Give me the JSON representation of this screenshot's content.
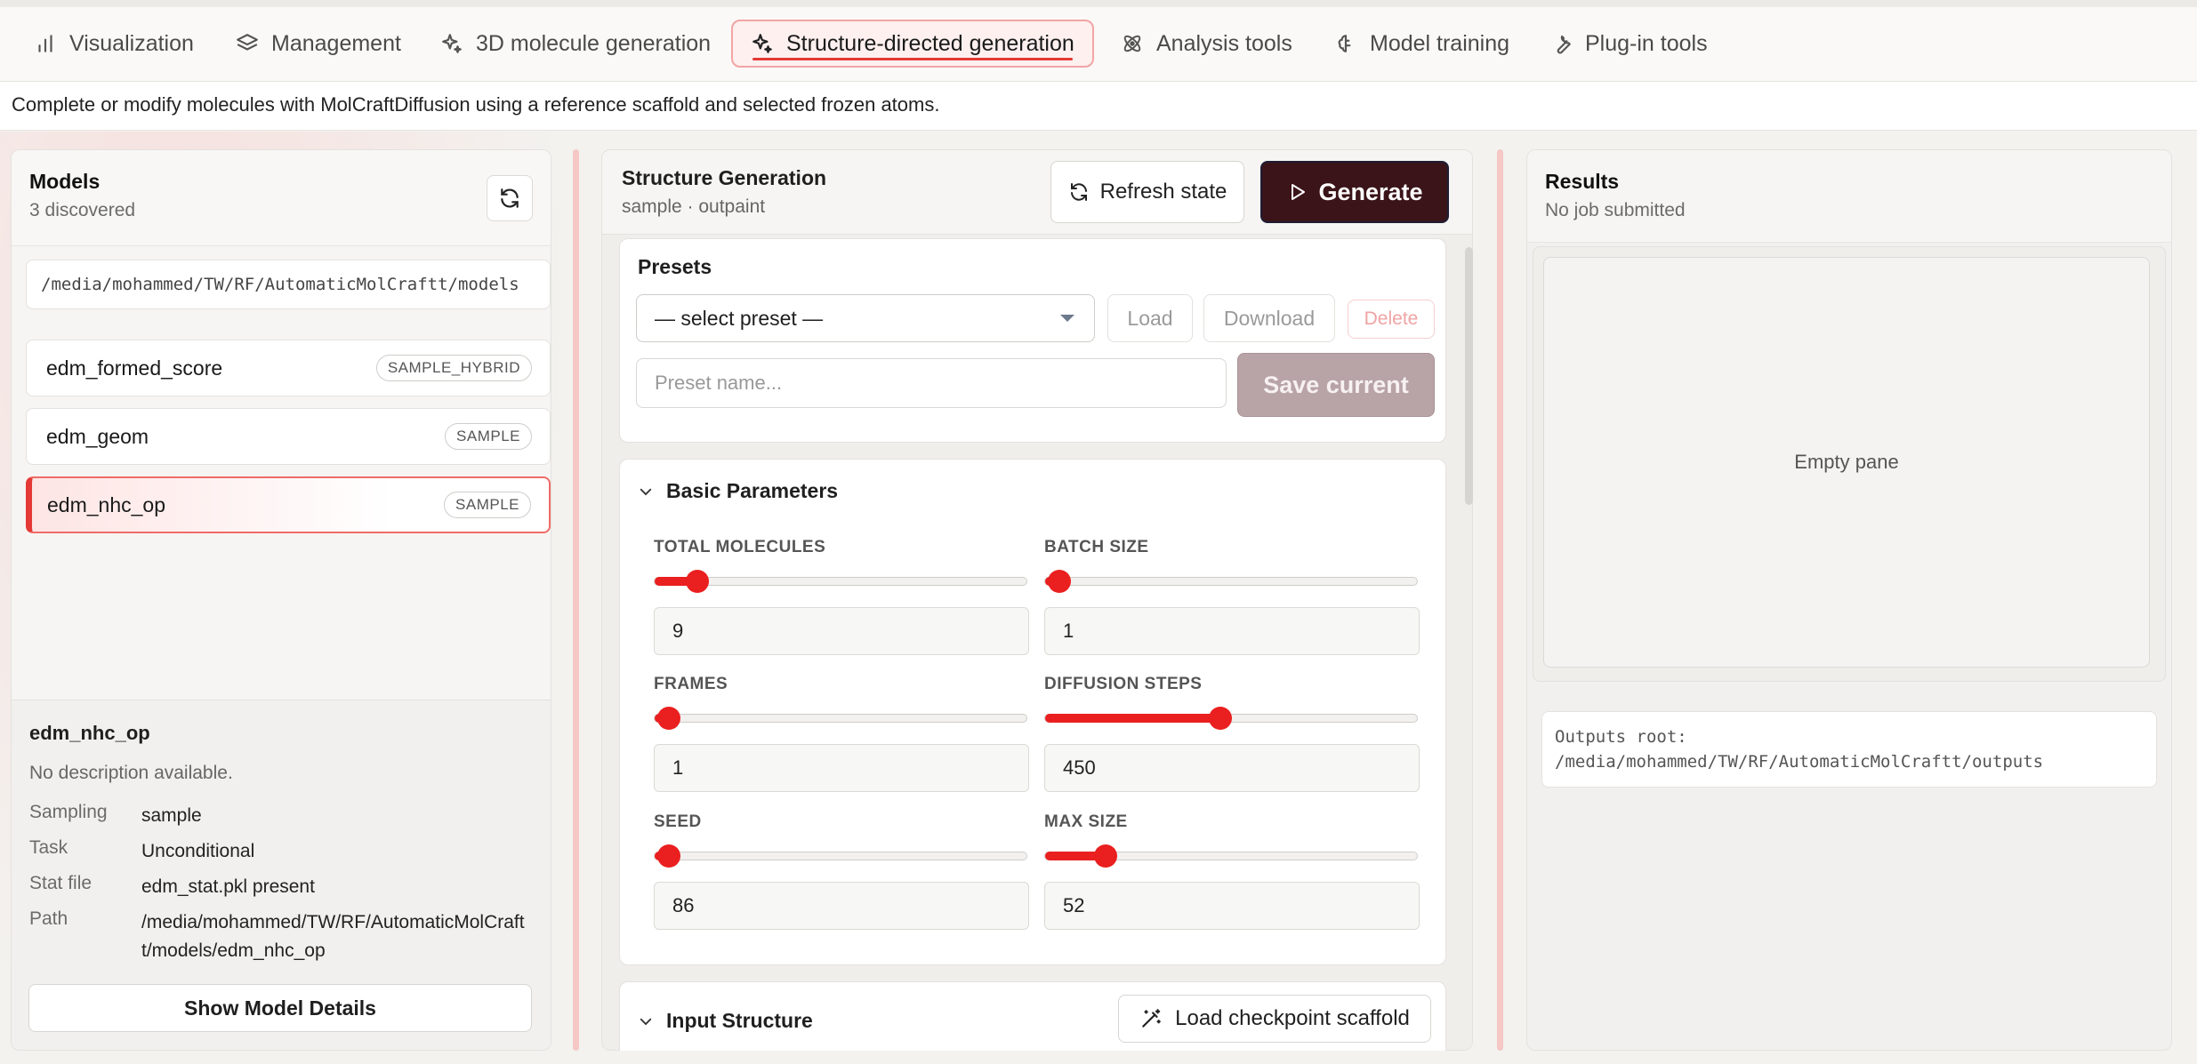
{
  "tabs": [
    {
      "label": "Visualization",
      "icon": "bar-chart-icon"
    },
    {
      "label": "Management",
      "icon": "layers-icon"
    },
    {
      "label": "3D molecule generation",
      "icon": "sparkles-icon"
    },
    {
      "label": "Structure-directed generation",
      "icon": "sparkles-icon",
      "active": true
    },
    {
      "label": "Analysis tools",
      "icon": "atom-icon"
    },
    {
      "label": "Model training",
      "icon": "brain-icon"
    },
    {
      "label": "Plug-in tools",
      "icon": "wrench-icon"
    }
  ],
  "description": "Complete or modify molecules with MolCraftDiffusion using a reference scaffold and selected frozen atoms.",
  "models_panel": {
    "title": "Models",
    "subtitle": "3 discovered",
    "path": "/media/mohammed/TW/RF/AutomaticMolCraftt/models",
    "items": [
      {
        "name": "edm_formed_score",
        "badge": "SAMPLE_HYBRID"
      },
      {
        "name": "edm_geom",
        "badge": "SAMPLE"
      },
      {
        "name": "edm_nhc_op",
        "badge": "SAMPLE",
        "selected": true
      }
    ],
    "details": {
      "name": "edm_nhc_op",
      "description": "No description available.",
      "fields": [
        {
          "key": "Sampling",
          "value": "sample"
        },
        {
          "key": "Task",
          "value": "Unconditional"
        },
        {
          "key": "Stat file",
          "value": "edm_stat.pkl present"
        },
        {
          "key": "Path",
          "value": "/media/mohammed/TW/RF/AutomaticMolCraftt/models/edm_nhc_op"
        }
      ],
      "show_button": "Show Model Details"
    }
  },
  "generation": {
    "title": "Structure Generation",
    "subtitle": "sample · outpaint",
    "refresh_label": "Refresh state",
    "generate_label": "Generate",
    "presets": {
      "title": "Presets",
      "select_value": "— select preset —",
      "load_label": "Load",
      "download_label": "Download",
      "delete_label": "Delete",
      "name_placeholder": "Preset name...",
      "save_label": "Save current"
    },
    "basic": {
      "title": "Basic Parameters",
      "params": [
        {
          "label": "TOTAL MOLECULES",
          "value": "9",
          "fraction": 0.08
        },
        {
          "label": "BATCH SIZE",
          "value": "1",
          "fraction": 0.0
        },
        {
          "label": "FRAMES",
          "value": "1",
          "fraction": 0.0
        },
        {
          "label": "DIFFUSION STEPS",
          "value": "450",
          "fraction": 0.45
        },
        {
          "label": "SEED",
          "value": "86",
          "fraction": 0.0
        },
        {
          "label": "MAX SIZE",
          "value": "52",
          "fraction": 0.13
        }
      ]
    },
    "input_structure": {
      "title": "Input Structure",
      "load_scaffold_label": "Load checkpoint scaffold"
    }
  },
  "results": {
    "title": "Results",
    "subtitle": "No job submitted",
    "empty_label": "Empty pane",
    "outputs_label": "Outputs root:",
    "outputs_path": "/media/mohammed/TW/RF/AutomaticMolCraftt/outputs"
  },
  "colors": {
    "accent": "#ea1f1f",
    "generate_bg": "#3a1418",
    "selected_border": "#e53935"
  }
}
